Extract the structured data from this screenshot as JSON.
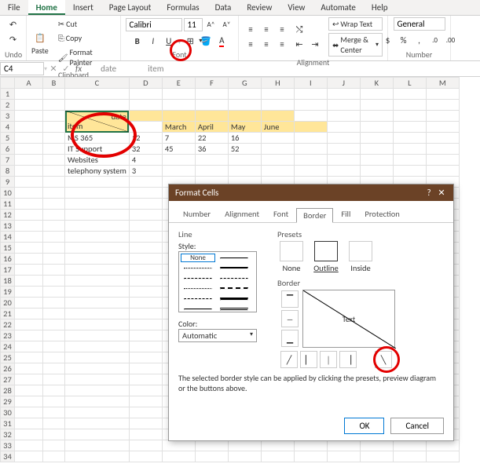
{
  "tabs": [
    "File",
    "Home",
    "Insert",
    "Page Layout",
    "Formulas",
    "Data",
    "Review",
    "View",
    "Automate",
    "Help"
  ],
  "active_tab": "Home",
  "ribbon": {
    "undo": "Undo",
    "clipboard": {
      "label": "Clipboard",
      "paste": "Paste",
      "cut": "Cut",
      "copy": "Copy",
      "format_painter": "Format Painter"
    },
    "font": {
      "label": "Font",
      "name": "Calibri",
      "size": "11"
    },
    "alignment": {
      "label": "Alignment",
      "wrap": "Wrap Text",
      "merge": "Merge & Center"
    },
    "number": {
      "label": "Number",
      "format": "General"
    }
  },
  "namebox": "C4",
  "fbar_headers": {
    "date": "date",
    "item": "item"
  },
  "columns": [
    "A",
    "B",
    "C",
    "D",
    "E",
    "F",
    "G",
    "H",
    "I",
    "J",
    "K",
    "L",
    "M"
  ],
  "diag": {
    "date": "date",
    "item": "item"
  },
  "months": [
    "March",
    "April",
    "May",
    "June"
  ],
  "rows": [
    {
      "label": "MS 365",
      "vals": [
        "12",
        "7",
        "22",
        "16"
      ]
    },
    {
      "label": "IT Support",
      "vals": [
        "32",
        "45",
        "36",
        "52"
      ]
    },
    {
      "label": "Websites",
      "vals": [
        "4",
        "",
        "",
        ""
      ]
    },
    {
      "label": "telephony system",
      "vals": [
        "3",
        "",
        "",
        ""
      ]
    }
  ],
  "dialog": {
    "title": "Format Cells",
    "tabs": [
      "Number",
      "Alignment",
      "Font",
      "Border",
      "Fill",
      "Protection"
    ],
    "active": "Border",
    "line": "Line",
    "style": "Style:",
    "none": "None",
    "color": "Color:",
    "automatic": "Automatic",
    "presets": "Presets",
    "preset_none": "None",
    "preset_outline": "Outline",
    "preset_inside": "Inside",
    "border": "Border",
    "preview_text": "Text",
    "hint": "The selected border style can be applied by clicking the presets, preview diagram or the buttons above.",
    "ok": "OK",
    "cancel": "Cancel"
  }
}
